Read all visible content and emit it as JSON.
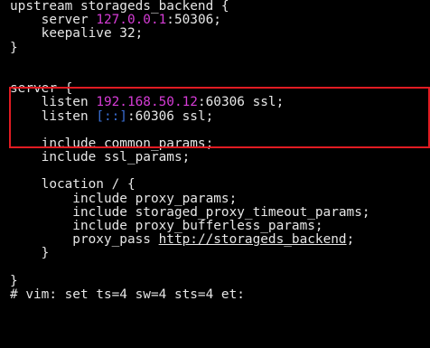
{
  "terminal": {
    "lines": [
      {
        "segments": [
          {
            "text": "upstream storageds_backend {",
            "style": "plain"
          }
        ]
      },
      {
        "segments": [
          {
            "text": "    server ",
            "style": "plain"
          },
          {
            "text": "127.0.0.1",
            "style": "ip"
          },
          {
            "text": ":50306;",
            "style": "plain"
          }
        ]
      },
      {
        "segments": [
          {
            "text": "    keepalive 32;",
            "style": "plain"
          }
        ]
      },
      {
        "segments": [
          {
            "text": "}",
            "style": "plain"
          }
        ]
      },
      {
        "segments": [
          {
            "text": "",
            "style": "plain"
          }
        ]
      },
      {
        "segments": [
          {
            "text": "",
            "style": "plain"
          }
        ]
      },
      {
        "segments": [
          {
            "text": "server {",
            "style": "plain"
          }
        ]
      },
      {
        "segments": [
          {
            "text": "    listen ",
            "style": "plain"
          },
          {
            "text": "192.168.50.12",
            "style": "ip"
          },
          {
            "text": ":60306 ssl;",
            "style": "plain"
          }
        ]
      },
      {
        "segments": [
          {
            "text": "    listen ",
            "style": "plain"
          },
          {
            "text": "[::]",
            "style": "ipv6"
          },
          {
            "text": ":60306 ssl;",
            "style": "plain"
          }
        ]
      },
      {
        "segments": [
          {
            "text": "",
            "style": "plain"
          }
        ]
      },
      {
        "segments": [
          {
            "text": "    include common_params;",
            "style": "plain"
          }
        ]
      },
      {
        "segments": [
          {
            "text": "    include ssl_params;",
            "style": "plain"
          }
        ]
      },
      {
        "segments": [
          {
            "text": "",
            "style": "plain"
          }
        ]
      },
      {
        "segments": [
          {
            "text": "    location / {",
            "style": "plain"
          }
        ]
      },
      {
        "segments": [
          {
            "text": "        include proxy_params;",
            "style": "plain"
          }
        ]
      },
      {
        "segments": [
          {
            "text": "        include storaged_proxy_timeout_params;",
            "style": "plain"
          }
        ]
      },
      {
        "segments": [
          {
            "text": "        include proxy_bufferless_params;",
            "style": "plain"
          }
        ]
      },
      {
        "segments": [
          {
            "text": "        proxy_pass ",
            "style": "plain"
          },
          {
            "text": "http://storageds_backend",
            "style": "url"
          },
          {
            "text": ";",
            "style": "plain"
          }
        ]
      },
      {
        "segments": [
          {
            "text": "    }",
            "style": "plain"
          }
        ]
      },
      {
        "segments": [
          {
            "text": "",
            "style": "plain"
          }
        ]
      },
      {
        "segments": [
          {
            "text": "}",
            "style": "plain"
          }
        ]
      },
      {
        "segments": [
          {
            "text": "# vim: set ts=4 sw=4 sts=4 et:",
            "style": "plain"
          }
        ]
      }
    ]
  },
  "colors": {
    "background": "#000000",
    "text": "#e6e6e6",
    "ip": "#d63cd6",
    "ipv6": "#3a6fd6",
    "highlight_border": "#e11b22"
  }
}
